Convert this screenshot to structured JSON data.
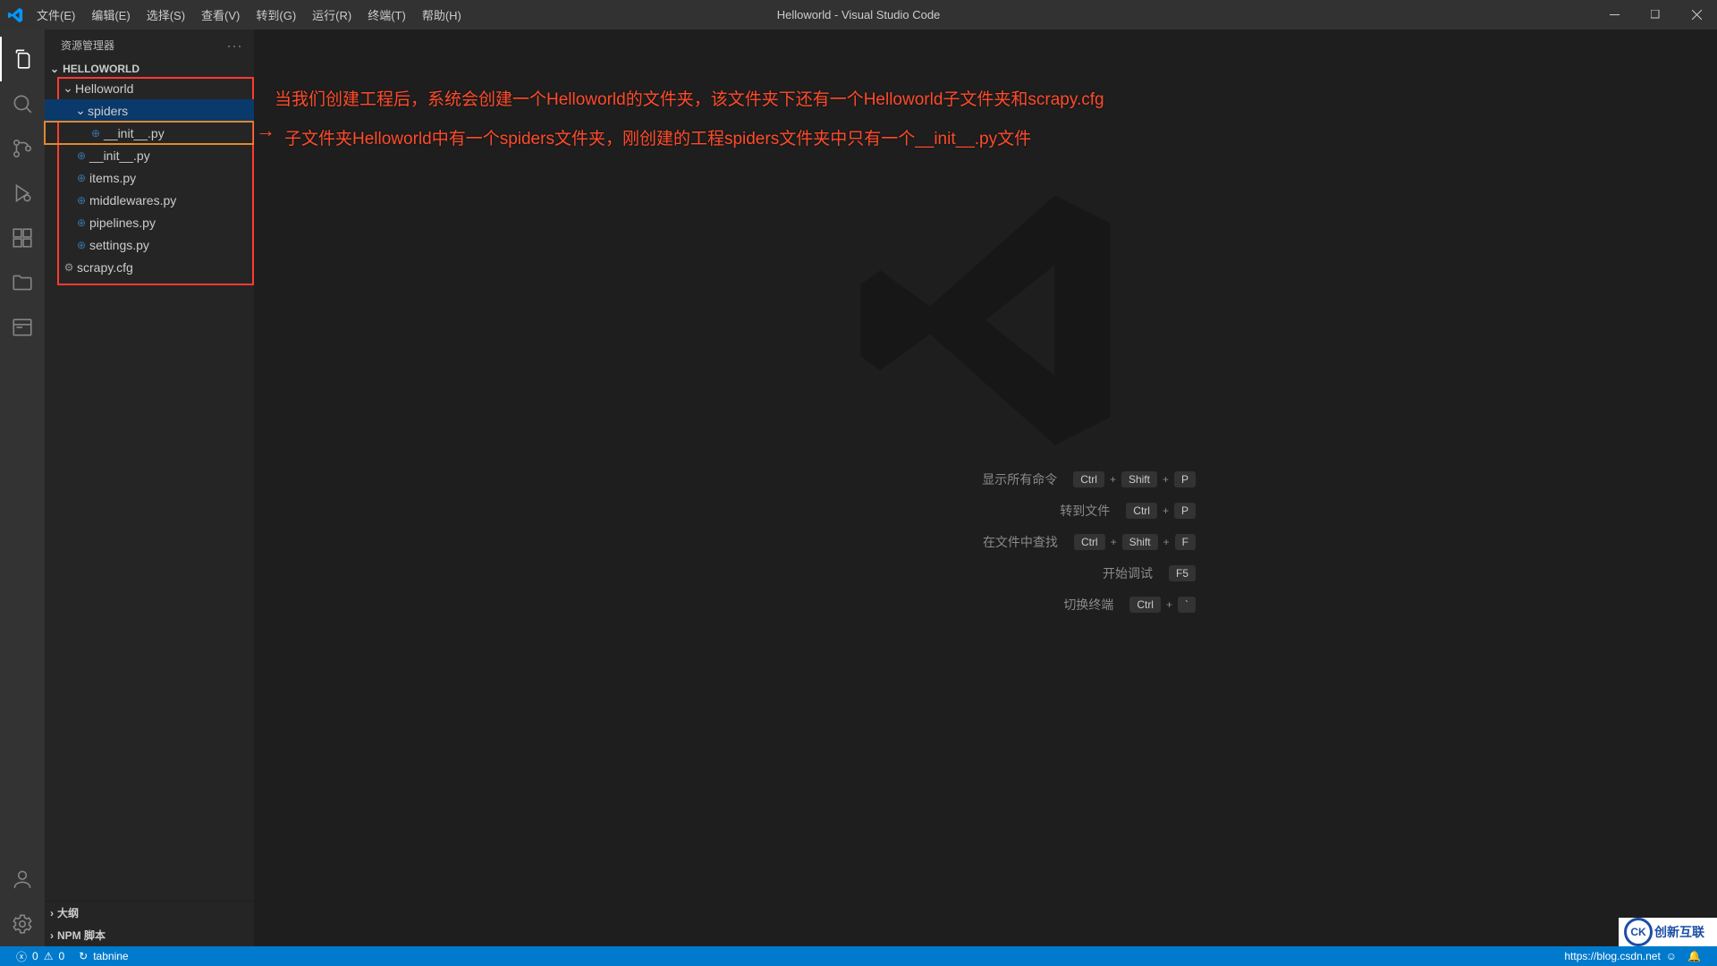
{
  "title_bar": {
    "app_title": "Helloworld - Visual Studio Code",
    "menu": [
      "文件(E)",
      "编辑(E)",
      "选择(S)",
      "查看(V)",
      "转到(G)",
      "运行(R)",
      "终端(T)",
      "帮助(H)"
    ]
  },
  "sidebar": {
    "header": "资源管理器",
    "root": "HELLOWORLD",
    "tree": {
      "project": "Helloworld",
      "spiders_folder": "spiders",
      "spiders_init": "__init__.py",
      "init_py": "__init__.py",
      "items_py": "items.py",
      "middlewares_py": "middlewares.py",
      "pipelines_py": "pipelines.py",
      "settings_py": "settings.py",
      "scrapy_cfg": "scrapy.cfg"
    },
    "panels": {
      "outline": "大纲",
      "npm": "NPM 脚本"
    }
  },
  "annotations": {
    "line1": "当我们创建工程后，系统会创建一个Helloworld的文件夹，该文件夹下还有一个Helloworld子文件夹和scrapy.cfg",
    "line2": "子文件夹Helloworld中有一个spiders文件夹，刚创建的工程spiders文件夹中只有一个__init__.py文件"
  },
  "shortcuts": [
    {
      "label": "显示所有命令",
      "keys": [
        "Ctrl",
        "Shift",
        "P"
      ]
    },
    {
      "label": "转到文件",
      "keys": [
        "Ctrl",
        "P"
      ]
    },
    {
      "label": "在文件中查找",
      "keys": [
        "Ctrl",
        "Shift",
        "F"
      ]
    },
    {
      "label": "开始调试",
      "keys": [
        "F5"
      ]
    },
    {
      "label": "切换终端",
      "keys": [
        "Ctrl",
        "`"
      ]
    }
  ],
  "status_bar": {
    "errors": "0",
    "warnings": "0",
    "tabnine": "tabnine",
    "footer_url": "https://blog.csdn.net"
  },
  "watermark": {
    "text": "创新互联",
    "initials": "CK"
  },
  "colors": {
    "accent_blue": "#007acc",
    "annotation_red": "#ff4b2b",
    "highlight_orange": "#e2872c"
  }
}
